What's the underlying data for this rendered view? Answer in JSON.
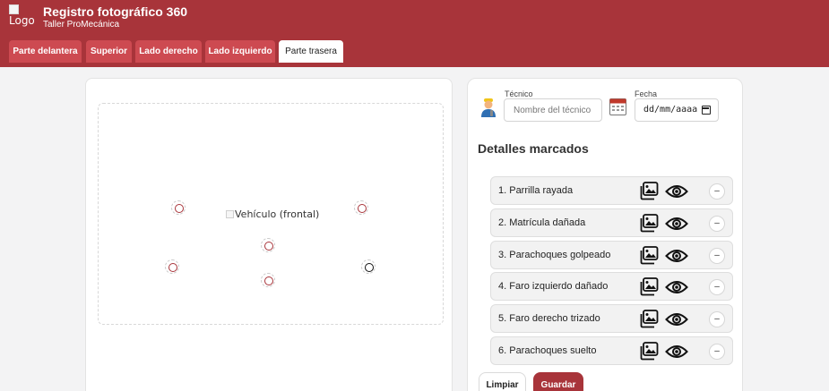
{
  "header": {
    "logo_alt": "Logo",
    "title": "Registro fotográfico 360",
    "subtitle": "Taller ProMecánica"
  },
  "tabs": [
    {
      "label": "Parte delantera",
      "active": false
    },
    {
      "label": "Superior",
      "active": false
    },
    {
      "label": "Lado derecho",
      "active": false
    },
    {
      "label": "Lado izquierdo",
      "active": false
    },
    {
      "label": "Parte trasera",
      "active": true
    }
  ],
  "canvas": {
    "vehicle_alt": "Vehículo (frontal)"
  },
  "form": {
    "tech_label": "Técnico",
    "tech_placeholder": "Nombre del técnico",
    "tech_value": "",
    "date_label": "Fecha",
    "date_value": "dd/mm/aaaa"
  },
  "details": {
    "title": "Detalles marcados",
    "items": [
      {
        "label": "1.  Parrilla rayada",
        "remove": "–"
      },
      {
        "label": "2.  Matrícula dañada",
        "remove": "–"
      },
      {
        "label": "3.  Parachoques golpeado",
        "remove": "–"
      },
      {
        "label": "4.  Faro izquierdo dañado",
        "remove": "–"
      },
      {
        "label": "5.  Faro derecho trizado",
        "remove": "–"
      },
      {
        "label": "6.  Parachoques suelto",
        "remove": "–"
      }
    ]
  },
  "actions": {
    "clear_label": "Limpiar",
    "save_label": "Guardar"
  },
  "colors": {
    "brand": "#a8343a",
    "tab": "#cd4a51",
    "background": "#f3f3f4"
  },
  "icons": {
    "technician": "mechanic-icon",
    "calendar": "calendar-icon",
    "photos": "images-icon",
    "view": "eye-icon"
  }
}
